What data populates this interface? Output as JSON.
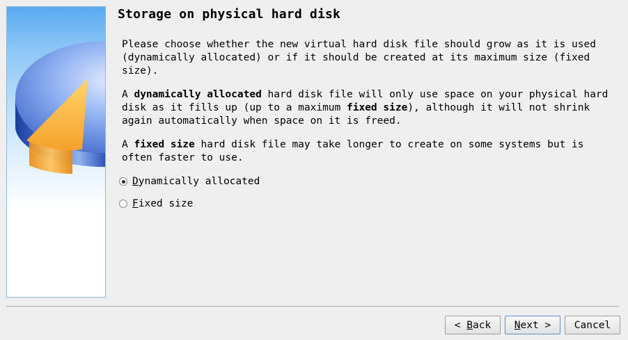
{
  "wizard": {
    "title": "Storage on physical hard disk",
    "paragraphs": {
      "p1": "Please choose whether the new virtual hard disk file should grow as it is used (dynamically allocated) or if it should be created at its maximum size (fixed size).",
      "p2_a": "A ",
      "p2_b": "dynamically allocated",
      "p2_c": " hard disk file will only use space on your physical hard disk as it fills up (up to a maximum ",
      "p2_d": "fixed size",
      "p2_e": "), although it will not shrink again automatically when space on it is freed.",
      "p3_a": "A ",
      "p3_b": "fixed size",
      "p3_c": " hard disk file may take longer to create on some systems but is often faster to use."
    },
    "options": {
      "dynamic": {
        "mnemonic": "D",
        "rest": "ynamically allocated",
        "checked": true
      },
      "fixed": {
        "mnemonic": "F",
        "rest": "ixed size",
        "checked": false
      }
    },
    "buttons": {
      "back": {
        "prefix": "< ",
        "mnemonic": "B",
        "rest": "ack"
      },
      "next": {
        "mnemonic": "N",
        "rest": "ext >"
      },
      "cancel": {
        "label": "Cancel"
      }
    }
  },
  "colors": {
    "accent": "#5b8fc5",
    "disk_top": "#4a7fd8",
    "disk_slice": "#f8a93a"
  }
}
